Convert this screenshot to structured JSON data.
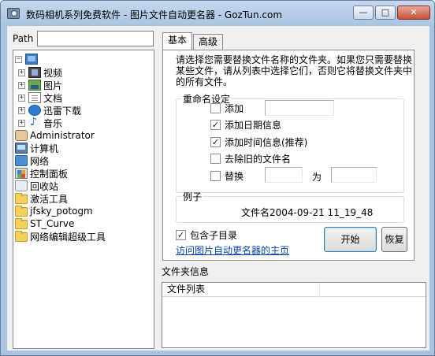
{
  "window": {
    "title": "数码相机系列免费软件 - 图片文件自动更名器 - GozTun.com",
    "controls": [
      "minimize",
      "maximize",
      "close"
    ]
  },
  "path": {
    "label": "Path",
    "value": ""
  },
  "tree": {
    "root": {
      "icon": "desktop-icon"
    },
    "items": [
      {
        "label": "视频",
        "icon": "video-folder-icon",
        "expander": "+"
      },
      {
        "label": "图片",
        "icon": "pictures-folder-icon",
        "expander": "+"
      },
      {
        "label": "文档",
        "icon": "documents-folder-icon",
        "expander": "+"
      },
      {
        "label": "迅雷下载",
        "icon": "thunder-download-icon",
        "expander": "+"
      },
      {
        "label": "音乐",
        "icon": "music-folder-icon",
        "expander": "+"
      },
      {
        "label": "Administrator",
        "icon": "user-folder-icon",
        "expander": ""
      },
      {
        "label": "计算机",
        "icon": "computer-icon",
        "expander": ""
      },
      {
        "label": "网络",
        "icon": "network-icon",
        "expander": ""
      },
      {
        "label": "控制面板",
        "icon": "control-panel-icon",
        "expander": ""
      },
      {
        "label": "回收站",
        "icon": "recycle-bin-icon",
        "expander": ""
      },
      {
        "label": "激活工具",
        "icon": "folder-icon",
        "expander": ""
      },
      {
        "label": "jfsky_potogm",
        "icon": "folder-icon",
        "expander": ""
      },
      {
        "label": "ST_Curve",
        "icon": "folder-icon",
        "expander": ""
      },
      {
        "label": "网络编辑超级工具",
        "icon": "folder-icon",
        "expander": ""
      }
    ]
  },
  "tabs": [
    {
      "label": "基本",
      "active": true
    },
    {
      "label": "高级",
      "active": false
    }
  ],
  "basic": {
    "instructions": "请选择您需要替换文件名称的文件夹。如果您只需要替换某些文件，请从列表中选择它们，否则它将替换文件夹中的所有文件。",
    "rename_group": {
      "legend": "重命名设定",
      "add": {
        "label": "添加",
        "checked": false,
        "value": ""
      },
      "add_date": {
        "label": "添加日期信息",
        "checked": true
      },
      "add_time": {
        "label": "添加时间信息(推荐)",
        "checked": true
      },
      "remove_old": {
        "label": "去除旧的文件名",
        "checked": false
      },
      "replace": {
        "label": "替换",
        "checked": false,
        "value": "",
        "to_label": "为",
        "to_value": ""
      }
    },
    "example": {
      "legend": "例子",
      "value": "文件名2004-09-21 11_19_48"
    },
    "include_subdirs": {
      "label": "包含子目录",
      "checked": true
    },
    "homepage_link": "访问图片自动更名器的主页",
    "start_button": "开始",
    "restore_button": "恢复"
  },
  "folder_info": {
    "label": "文件夹信息",
    "columns": [
      "文件列表",
      ""
    ]
  }
}
